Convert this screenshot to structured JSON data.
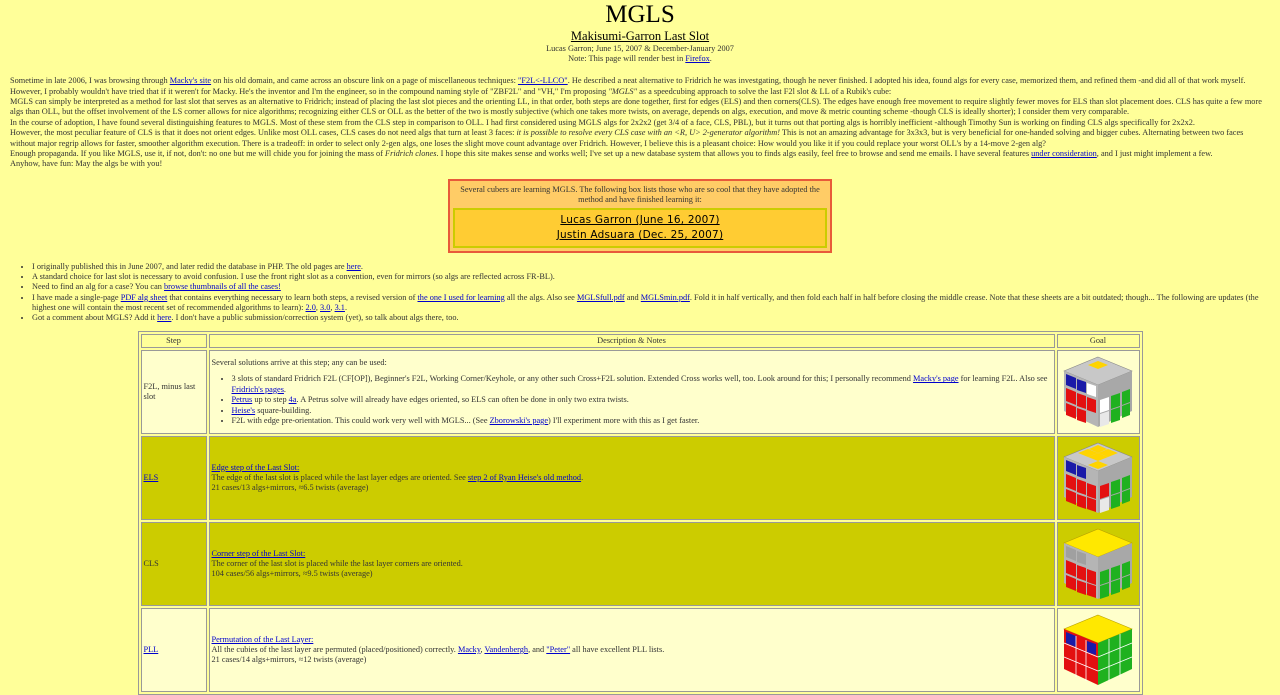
{
  "header": {
    "title": "MGLS",
    "subtitle": "Makisumi-Garron Last Slot",
    "byline": "Lucas Garron; June 15, 2007 & December-January 2007",
    "note_prefix": "Note: This page will render best in ",
    "note_link": "Firefox",
    "note_suffix": "."
  },
  "intro": {
    "p1": [
      "Sometime in late 2006, I was browsing through ",
      "Macky's site",
      " on his old domain, and came across an obscure link on a page of miscellaneous techniques: ",
      "\"F2L<-LLCO\"",
      ". He described a neat alternative to Fridrich he was investgating, though he never finished. I adopted his idea, found algs for every case, memorized them, and refined them -and did all of that work myself. However, I probably wouldn't have tried that if it weren't for Macky. He's the inventor and I'm the engineer, so in the compound naming style of \"ZBF2L\" and \"VH,\" I'm proposing ",
      "\"MGLS\"",
      " as a speedcubing approach to solve the last F2l slot & LL of a Rubik's cube:"
    ],
    "p2": "MGLS can simply be interpreted as a method for last slot that serves as an alternative to Fridrich; instead of placing the last slot pieces and the orienting LL, in that order, both steps are done together, first for edges (ELS) and then corners(CLS). The edges have enough free movement to require slightly fewer moves for ELS than slot placement does. CLS has quite a few more algs than OLL, but the offset involvement of the LS corner allows for nice algorithms; recognizing either CLS or OLL as the better of the two is mostly subjective (which one takes more twists, on average, depends on algs, execution, and move & metric counting scheme -though CLS is ideally shorter); I consider them very comparable.",
    "p3": "In the course of adoption, I have found several distinguishing features to MGLS. Most of these stem from the CLS step in comparison to OLL. I had first considered using MGLS algs for 2x2x2 (get 3/4 of a face, CLS, PBL), but it turns out that porting algs is horribly inefficient -although Timothy Sun is working on finding CLS algs specifically for 2x2x2.",
    "p4": [
      "However, the most peculiar feature of CLS is that it does not orient edges. Unlike most OLL cases, CLS cases do not need algs that turn at least 3 faces: ",
      "it is possible to resolve every CLS case with an <R, U> 2-generator algorithm!",
      " This is not an amazing advantage for 3x3x3, but is very beneficial for one-handed solving and bigger cubes. Alternating between two faces without major regrip allows for faster, smoother algorithm execution. There is a tradeoff: in order to select only 2-gen algs, one loses the slight move count advantage over Fridrich. However, I believe this is a pleasant choice: How would you like it if you could replace your worst OLL's by a 14-move 2-gen alg?"
    ],
    "p5": [
      "Enough propaganda. If you like MGLS, use it, if not, don't: no one but me will chide you for joining the mass of ",
      "Fridrich clones",
      ". I hope this site makes sense and works well; I've set up a new database system that allows you to finds algs easily, feel free to browse and send me emails. I have several features ",
      "under consideration",
      ", and I just might implement a few."
    ],
    "p6": "Anyhow, have fun: May the algs be with you!"
  },
  "learners": {
    "note": "Several cubers are learning MGLS. The following box lists those who are so cool that they have adopted the method and have finished learning it:",
    "names": [
      "Lucas Garron (June 16, 2007)",
      "Justin Adsuara (Dec. 25, 2007)"
    ]
  },
  "bullets": {
    "b1": [
      "I originally published this in June 2007, and later redid the database in PHP. The old pages are ",
      "here",
      "."
    ],
    "b2": "A standard choice for last slot is necessary to avoid confusion. I use the front right slot as a convention, even for mirrors (so algs are reflected across FR-BL).",
    "b3": [
      "Need to find an alg for a case? You can ",
      "browse thumbnails of all the cases!"
    ],
    "b4": [
      "I have made a single-page ",
      "PDF alg sheet",
      " that contains everything necessary to learn both steps, a revised version of ",
      "the one I used for learning",
      " all the algs. Also see ",
      "MGLSfull.pdf",
      " and ",
      "MGLSmin.pdf",
      ". Fold it in half vertically, and then fold each half in half before closing the middle crease. Note that these sheets are a bit outdated; though... The following are updates (the highest one will contain the most recent set of recommended algorithms to learn): ",
      "2.0",
      ", ",
      "3.0",
      ", ",
      "3.1",
      "."
    ],
    "b5": [
      "Got a comment about MGLS? Add it ",
      "here",
      ". I don't have a public submission/correction system (yet), so talk about algs there, too."
    ]
  },
  "table": {
    "headers": [
      "Step",
      "Description & Notes",
      "Goal"
    ],
    "row1": {
      "step": "F2L, minus last slot",
      "intro": "Several solutions arrive at this step; any can be used:",
      "li1": [
        "3 slots of standard Fridrich F2L (CF[OP]), Beginner's F2L, Working Corner/Keyhole, or any other such Cross+F2L solution. Extended Cross works well, too. Look around for this; I personally recommend ",
        "Macky's page",
        " for learning F2L. Also see ",
        "Fridrich's pages",
        "."
      ],
      "li2": [
        "Petrus",
        " up to step ",
        "4a",
        ". A Petrus solve will already have edges oriented, so ELS can often be done in only two extra twists."
      ],
      "li3": [
        "Heise's",
        " square-building."
      ],
      "li4": [
        "F2L with edge pre-orientation. This could work very well with MGLS... (See ",
        "Zborowski's page",
        ") I'll experiment more with this as I get faster."
      ]
    },
    "row2": {
      "step": "ELS",
      "title": "Edge step of the Last Slot:",
      "line": [
        "The edge of the last slot is placed while the last layer edges are oriented. See ",
        "step 2 of Ryan Heise's old method",
        "."
      ],
      "stats": "21 cases/13 algs+mirrors, ≈6.5 twists (average)"
    },
    "row3": {
      "step": "CLS",
      "title": "Corner step of the Last Slot:",
      "line": "The corner of the last slot is placed while the last layer corners are oriented.",
      "stats": "104 cases/56 algs+mirrors, ≈9.5 twists (average)"
    },
    "row4": {
      "step": "PLL",
      "title": "Permutation of the Last Layer:",
      "line": [
        "All the cubies of the last layer are permuted (placed/positioned) correctly. ",
        "Macky",
        ", ",
        "Vandenbergh",
        ", and ",
        "\"Peter\"",
        " all have excellent PLL lists."
      ],
      "stats": "21 cases/14 algs+mirrors, ≈12 twists (average)"
    }
  },
  "colors": {
    "background": "#ffff99",
    "link": "#0000cc",
    "row_dark": "#cccc00",
    "row_light": "#ffffcc",
    "box_fill": "#ffcc66",
    "box_border": "#e85a3a"
  },
  "cube_icons": [
    "f2l-cube-icon",
    "els-cube-icon",
    "cls-cube-icon",
    "pll-cube-icon"
  ]
}
